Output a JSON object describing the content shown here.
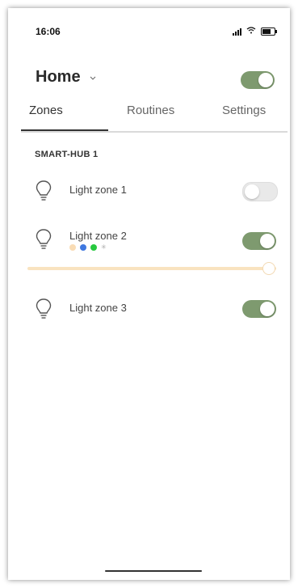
{
  "status_bar": {
    "time": "16:06"
  },
  "header": {
    "title": "Home"
  },
  "tabs": [
    {
      "label": "Zones",
      "active": true
    },
    {
      "label": "Routines",
      "active": false
    },
    {
      "label": "Settings",
      "active": false
    }
  ],
  "section": {
    "title": "SMART-HUB 1"
  },
  "zones": [
    {
      "label": "Light zone 1",
      "on": false
    },
    {
      "label": "Light zone 2",
      "on": true,
      "brightness_percent": 100,
      "color_dots": [
        "#f9dcb5",
        "#3f78e0",
        "#27c93f",
        "#bfbfbf"
      ]
    },
    {
      "label": "Light zone 3",
      "on": true
    }
  ],
  "colors": {
    "accent": "#7e9a6f",
    "track": "#f9e3c0"
  }
}
